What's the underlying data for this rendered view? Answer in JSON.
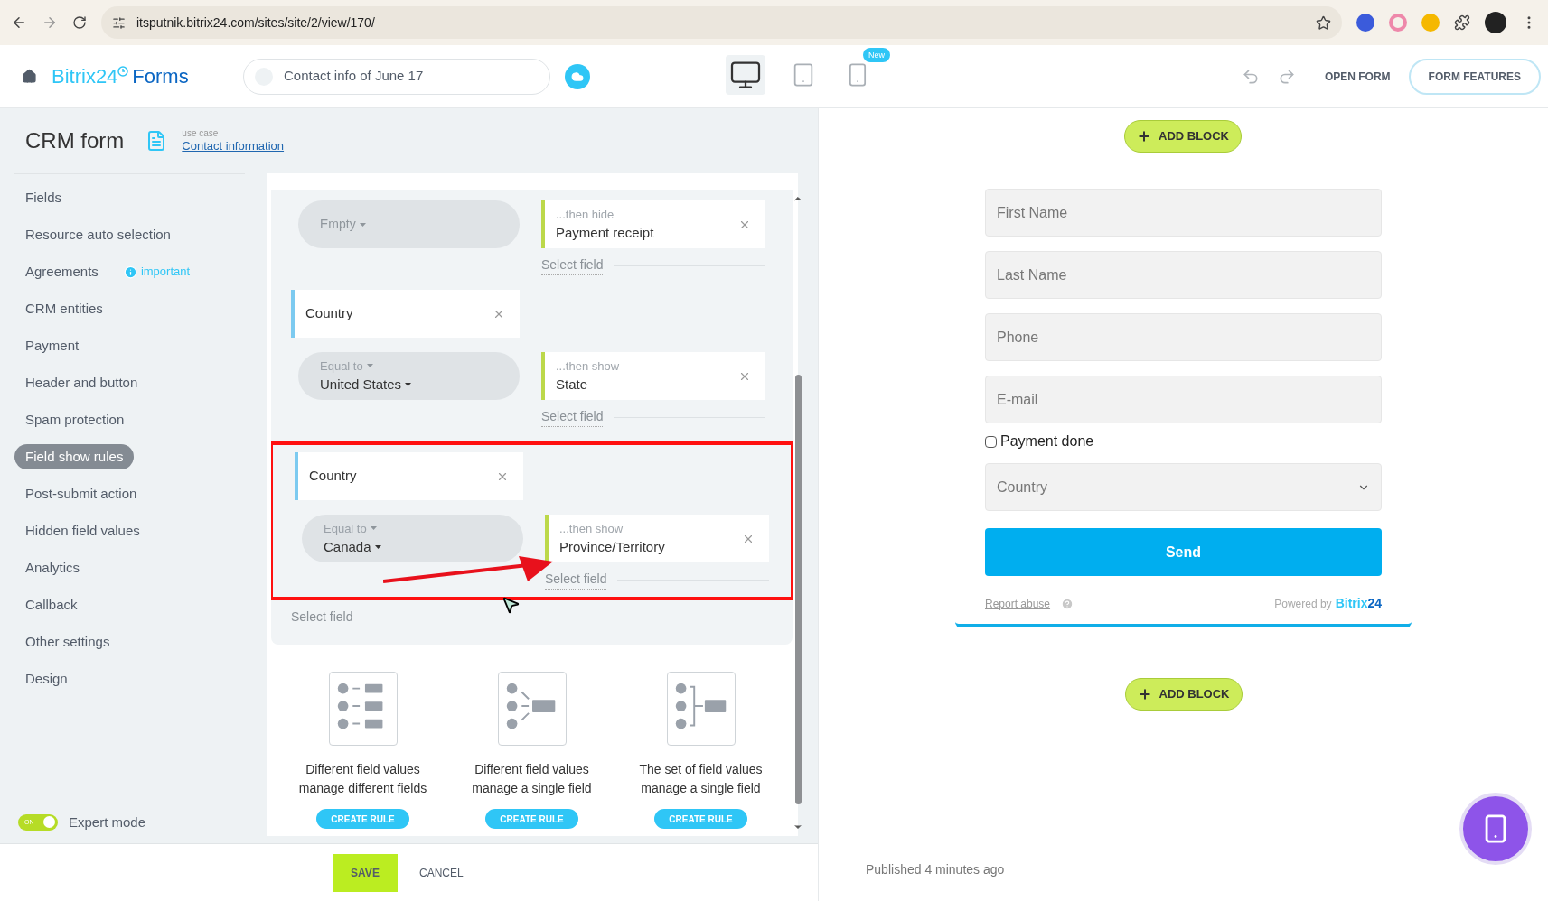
{
  "browser": {
    "url": "itsputnik.bitrix24.com/sites/site/2/view/170/"
  },
  "header": {
    "logo_brand": "Bitrix24",
    "logo_product": "Forms",
    "form_name": "Contact info of June 17",
    "devices": [
      {
        "kind": "desktop",
        "selected": true
      },
      {
        "kind": "tablet",
        "selected": false
      },
      {
        "kind": "mobile",
        "selected": false,
        "badge": "New"
      }
    ],
    "open_form": "OPEN FORM",
    "form_features": "FORM FEATURES"
  },
  "panel": {
    "title": "CRM form",
    "use_case_label": "use case",
    "use_case": "Contact information"
  },
  "sidebar": {
    "items": [
      {
        "label": "Fields",
        "selected": false
      },
      {
        "label": "Resource auto selection",
        "selected": false
      },
      {
        "label": "Agreements",
        "selected": false,
        "badge": "important"
      },
      {
        "label": "CRM entities",
        "selected": false
      },
      {
        "label": "Payment",
        "selected": false
      },
      {
        "label": "Header and button",
        "selected": false
      },
      {
        "label": "Spam protection",
        "selected": false
      },
      {
        "label": "Field show rules",
        "selected": true
      },
      {
        "label": "Post-submit action",
        "selected": false
      },
      {
        "label": "Hidden field values",
        "selected": false
      },
      {
        "label": "Analytics",
        "selected": false
      },
      {
        "label": "Callback",
        "selected": false
      },
      {
        "label": "Other settings",
        "selected": false
      },
      {
        "label": "Design",
        "selected": false
      }
    ],
    "expert_mode": {
      "label": "Expert mode",
      "toggle_text": "ON",
      "on": true
    }
  },
  "rules": {
    "groups": [
      {
        "condition": "Empty",
        "action": "...then hide",
        "target": "Payment receipt",
        "select_field": "Select field",
        "highlighted": false
      },
      {
        "field": "Country",
        "condition": "Equal to",
        "value": "United States",
        "action": "...then show",
        "target": "State",
        "select_field": "Select field",
        "highlighted": false
      },
      {
        "field": "Country",
        "condition": "Equal to",
        "value": "Canada",
        "action": "...then show",
        "target": "Province/Territory",
        "select_field": "Select field",
        "highlighted": true
      }
    ],
    "select_field": "Select field"
  },
  "templates": [
    {
      "kind": "many-to-many",
      "line1": "Different field values",
      "line2": "manage different fields",
      "button": "CREATE RULE"
    },
    {
      "kind": "many-to-one",
      "line1": "Different field values",
      "line2": "manage a single field",
      "button": "CREATE RULE"
    },
    {
      "kind": "set-to-one",
      "line1": "The set of field values",
      "line2": "manage a single field",
      "button": "CREATE RULE"
    }
  ],
  "footer": {
    "save": "SAVE",
    "cancel": "CANCEL"
  },
  "preview": {
    "add_block": "ADD BLOCK",
    "fields": [
      {
        "placeholder": "First Name"
      },
      {
        "placeholder": "Last Name"
      },
      {
        "placeholder": "Phone"
      },
      {
        "placeholder": "E-mail"
      }
    ],
    "checkbox": {
      "label": "Payment done",
      "checked": false
    },
    "select": {
      "placeholder": "Country"
    },
    "send": "Send",
    "report_abuse": "Report abuse",
    "powered_by": "Powered by",
    "brand": "Bitrix",
    "brand_num": "24",
    "add_block_bottom": "ADD BLOCK",
    "published": "Published 4 minutes ago"
  }
}
